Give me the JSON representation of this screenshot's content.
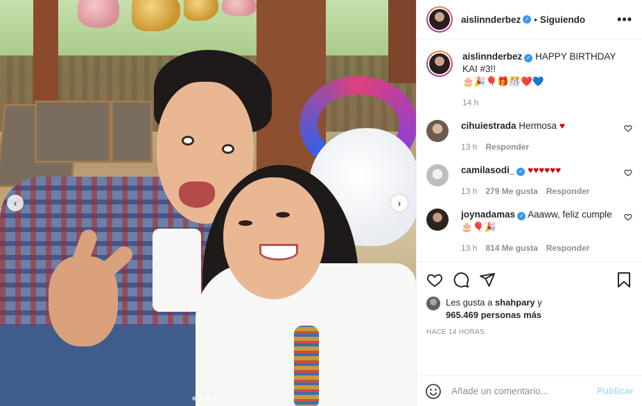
{
  "post": {
    "username": "aislinnderbez",
    "verified": "✓",
    "separator": "•",
    "following_label": "Siguiendo",
    "more_label": "•••"
  },
  "caption": {
    "username": "aislinnderbez",
    "text": "HAPPY BIRTHDAY KAI #3!!",
    "emoji_line": "🎂🎉🎈🎁🎊❤️💙",
    "time": "14 h"
  },
  "comments": [
    {
      "username": "cihuiestrada",
      "verified": false,
      "text": "Hermosa",
      "suffix": "♥",
      "time": "13 h",
      "likes": "",
      "reply_label": "Responder"
    },
    {
      "username": "camilasodi_",
      "verified": true,
      "text": "",
      "suffix": "♥♥♥♥♥♥",
      "time": "13 h",
      "likes": "279 Me gusta",
      "reply_label": "Responder"
    },
    {
      "username": "joynadamas",
      "verified": true,
      "text": "Aaaww, feliz cumple 🎂🎈🎉",
      "suffix": "",
      "time": "13 h",
      "likes": "814 Me gusta",
      "reply_label": "Responder"
    }
  ],
  "likes": {
    "prefix": "Les gusta a",
    "user": "shahpary",
    "conj": "y",
    "count_text": "965.469 personas más"
  },
  "posted_ago": "HACE 14 HORAS",
  "add_comment": {
    "placeholder": "Añade un comentario...",
    "publish_label": "Publicar"
  },
  "carousel": {
    "dots": 5,
    "active_index": 2
  },
  "colors": {
    "verified": "#3897f0",
    "heart": "#d0021b",
    "publish": "#b2dffc",
    "muted": "#8e8e8e"
  }
}
